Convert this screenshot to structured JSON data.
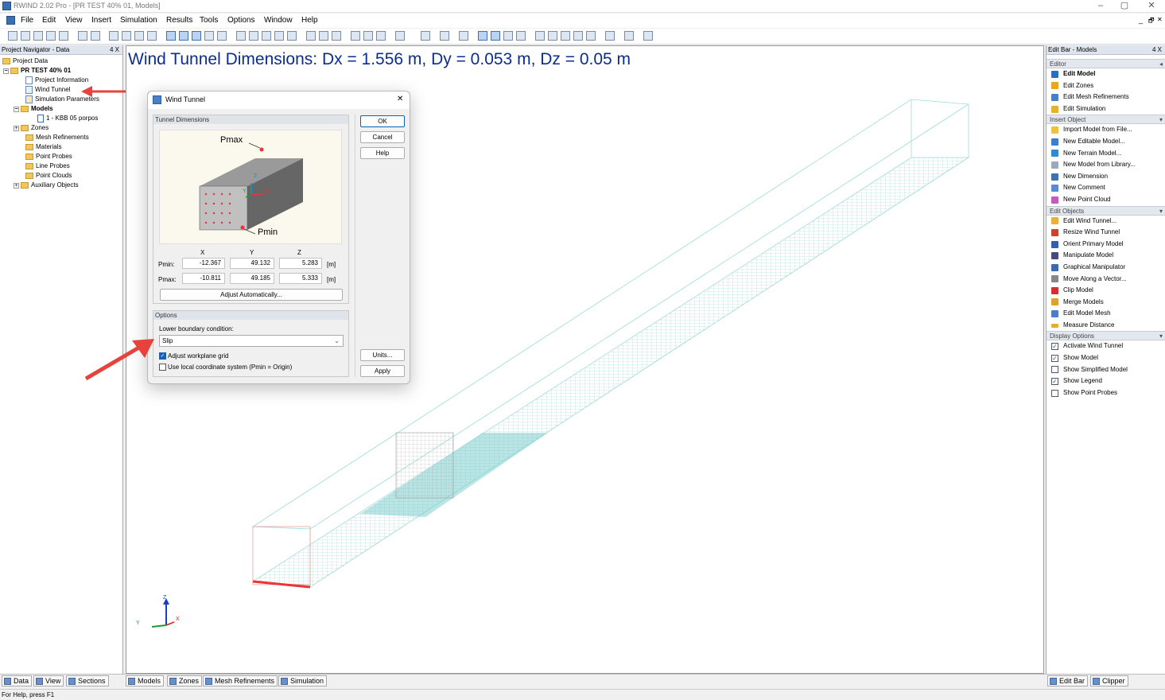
{
  "window": {
    "title": "RWIND 2.02 Pro - [PR TEST 40% 01, Models]",
    "minimize": "–",
    "maximize": "▢",
    "close": "✕",
    "mdi_minimize": "_",
    "mdi_restore": "🗗",
    "mdi_close": "✕"
  },
  "menu": [
    "File",
    "Edit",
    "View",
    "Insert",
    "Simulation",
    "Results",
    "Tools",
    "Options",
    "Window",
    "Help"
  ],
  "navigator": {
    "title": "Project Navigator - Data",
    "pin": "4 X",
    "root": "Project Data",
    "project": "PR TEST 40% 01",
    "items": {
      "project_info": "Project Information",
      "wind_tunnel": "Wind Tunnel",
      "sim_params": "Simulation Parameters",
      "models": "Models",
      "model1": "1 - KBB 05 porpos",
      "zones": "Zones",
      "mesh": "Mesh Refinements",
      "materials": "Materials",
      "point_probes": "Point Probes",
      "line_probes": "Line Probes",
      "point_clouds": "Point Clouds",
      "aux": "Auxiliary Objects"
    },
    "tabs": [
      "Data",
      "View",
      "Sections"
    ]
  },
  "viewport": {
    "heading": "Wind Tunnel Dimensions: Dx = 1.556 m, Dy = 0.053 m, Dz = 0.05 m",
    "tabs": [
      "Models",
      "Zones",
      "Mesh Refinements",
      "Simulation"
    ],
    "axes": {
      "z": "Z",
      "y": "Y",
      "x": "X"
    }
  },
  "dialog": {
    "title": "Wind Tunnel",
    "close": "✕",
    "dims_group": "Tunnel Dimensions",
    "pmax_label": "Pmax",
    "pmin_label": "Pmin",
    "col_x": "X",
    "col_y": "Y",
    "col_z": "Z",
    "pmin_row_label": "Pmin:",
    "pmax_row_label": "Pmax:",
    "pmin": {
      "x": "-12.367",
      "y": "49.132",
      "z": "5.283"
    },
    "pmax": {
      "x": "-10.811",
      "y": "49.185",
      "z": "5.333"
    },
    "unit": "[m]",
    "adjust_btn": "Adjust Automatically...",
    "options_group": "Options",
    "lower_boundary_label": "Lower boundary condition:",
    "lower_boundary_value": "Slip",
    "adjust_grid": "Adjust workplane grid",
    "use_local": "Use local coordinate system (Pmin = Origin)",
    "ok": "OK",
    "cancel": "Cancel",
    "help": "Help",
    "units": "Units...",
    "apply": "Apply"
  },
  "editbar": {
    "title": "Edit Bar - Models",
    "pin": "4 X",
    "sections": {
      "editor": "Editor",
      "insert": "Insert Object",
      "edit_objects": "Edit Objects",
      "display": "Display Options"
    },
    "editor_items": [
      "Edit Model",
      "Edit Zones",
      "Edit Mesh Refinements",
      "Edit Simulation"
    ],
    "insert_items": [
      "Import Model from File...",
      "New Editable Model...",
      "New Terrain Model...",
      "New Model from Library...",
      "New Dimension",
      "New Comment",
      "New Point Cloud"
    ],
    "edit_items": [
      "Edit Wind Tunnel...",
      "Resize Wind Tunnel",
      "Orient Primary Model",
      "Manipulate Model",
      "Graphical Manipulator",
      "Move Along a Vector...",
      "Clip Model",
      "Merge Models",
      "Edit Model Mesh",
      "Measure Distance"
    ],
    "display_items": [
      "Activate Wind Tunnel",
      "Show Model",
      "Show Simplified Model",
      "Show Legend",
      "Show Point Probes"
    ],
    "display_checked": [
      true,
      true,
      false,
      true,
      false
    ],
    "tabs": [
      "Edit Bar",
      "Clipper"
    ]
  },
  "status": "For Help, press F1",
  "colors": {
    "heading": "#0c2d8c",
    "mesh": "#7fcfcf",
    "arrow": "#e8423c"
  }
}
